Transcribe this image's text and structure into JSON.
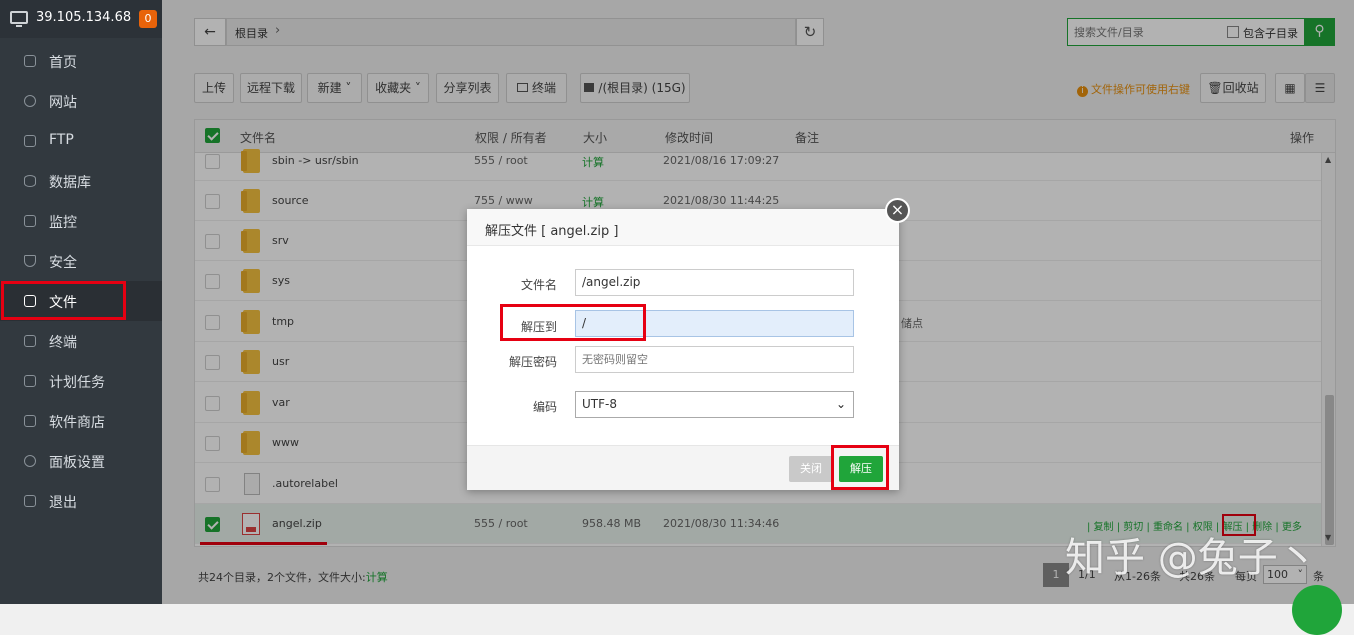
{
  "sidebar": {
    "server_ip": "39.105.134.68",
    "badge": "0",
    "items": [
      {
        "label": "首页",
        "icon": "home-icon"
      },
      {
        "label": "网站",
        "icon": "globe-icon"
      },
      {
        "label": "FTP",
        "icon": "ftp-icon"
      },
      {
        "label": "数据库",
        "icon": "database-icon"
      },
      {
        "label": "监控",
        "icon": "monitor-icon"
      },
      {
        "label": "安全",
        "icon": "shield-icon"
      },
      {
        "label": "文件",
        "icon": "folder-icon"
      },
      {
        "label": "终端",
        "icon": "terminal-icon"
      },
      {
        "label": "计划任务",
        "icon": "calendar-icon"
      },
      {
        "label": "软件商店",
        "icon": "grid-icon"
      },
      {
        "label": "面板设置",
        "icon": "gear-icon"
      },
      {
        "label": "退出",
        "icon": "logout-icon"
      }
    ]
  },
  "pathbar": {
    "crumb": "根目录",
    "sep": "›"
  },
  "search": {
    "placeholder": "搜索文件/目录",
    "sub_label": "包含子目录"
  },
  "toolbar": {
    "upload": "上传",
    "remote_download": "远程下载",
    "new": "新建",
    "favorites": "收藏夹",
    "share_list": "分享列表",
    "terminal": "终端",
    "disk": "/(根目录) (15G)",
    "tip": "文件操作可使用右键",
    "recycle": "回收站"
  },
  "table": {
    "headers": {
      "name": "文件名",
      "perm": "权限 / 所有者",
      "size": "大小",
      "mtime": "修改时间",
      "note": "备注",
      "ops": "操作"
    },
    "rows": [
      {
        "name": "sbin -> usr/sbin",
        "perm": "555 / root",
        "size": "计算",
        "mtime": "2021/08/16 17:09:27"
      },
      {
        "name": "source",
        "perm": "755 / www",
        "size": "计算",
        "mtime": "2021/08/30 11:44:25"
      },
      {
        "name": "srv"
      },
      {
        "name": "sys"
      },
      {
        "name": "tmp",
        "note": "储点"
      },
      {
        "name": "usr"
      },
      {
        "name": "var"
      },
      {
        "name": "www"
      },
      {
        "name": ".autorelabel"
      },
      {
        "name": "angel.zip",
        "perm": "555 / root",
        "size": "958.48 MB",
        "mtime": "2021/08/30 11:34:46"
      }
    ],
    "row_actions": "| 复制 | 剪切 | 重命名 | 权限 | 解压 | 删除 | 更多"
  },
  "footer": {
    "summary": "共24个目录，2个文件，文件大小:",
    "calc": "计算",
    "page": "1",
    "pages": "1/1",
    "range": "从1-26条",
    "total": "共26条",
    "per_page_label": "每页",
    "per_page": "100",
    "unit": "条"
  },
  "dialog": {
    "title": "解压文件 [ angel.zip ]",
    "filename_label": "文件名",
    "filename_value": "/angel.zip",
    "extract_to_label": "解压到",
    "extract_to_value": "/",
    "password_label": "解压密码",
    "password_placeholder": "无密码则留空",
    "encoding_label": "编码",
    "encoding_value": "UTF-8",
    "close_button": "关闭",
    "extract_button": "解压"
  },
  "watermark": "知乎 @兔子丶"
}
